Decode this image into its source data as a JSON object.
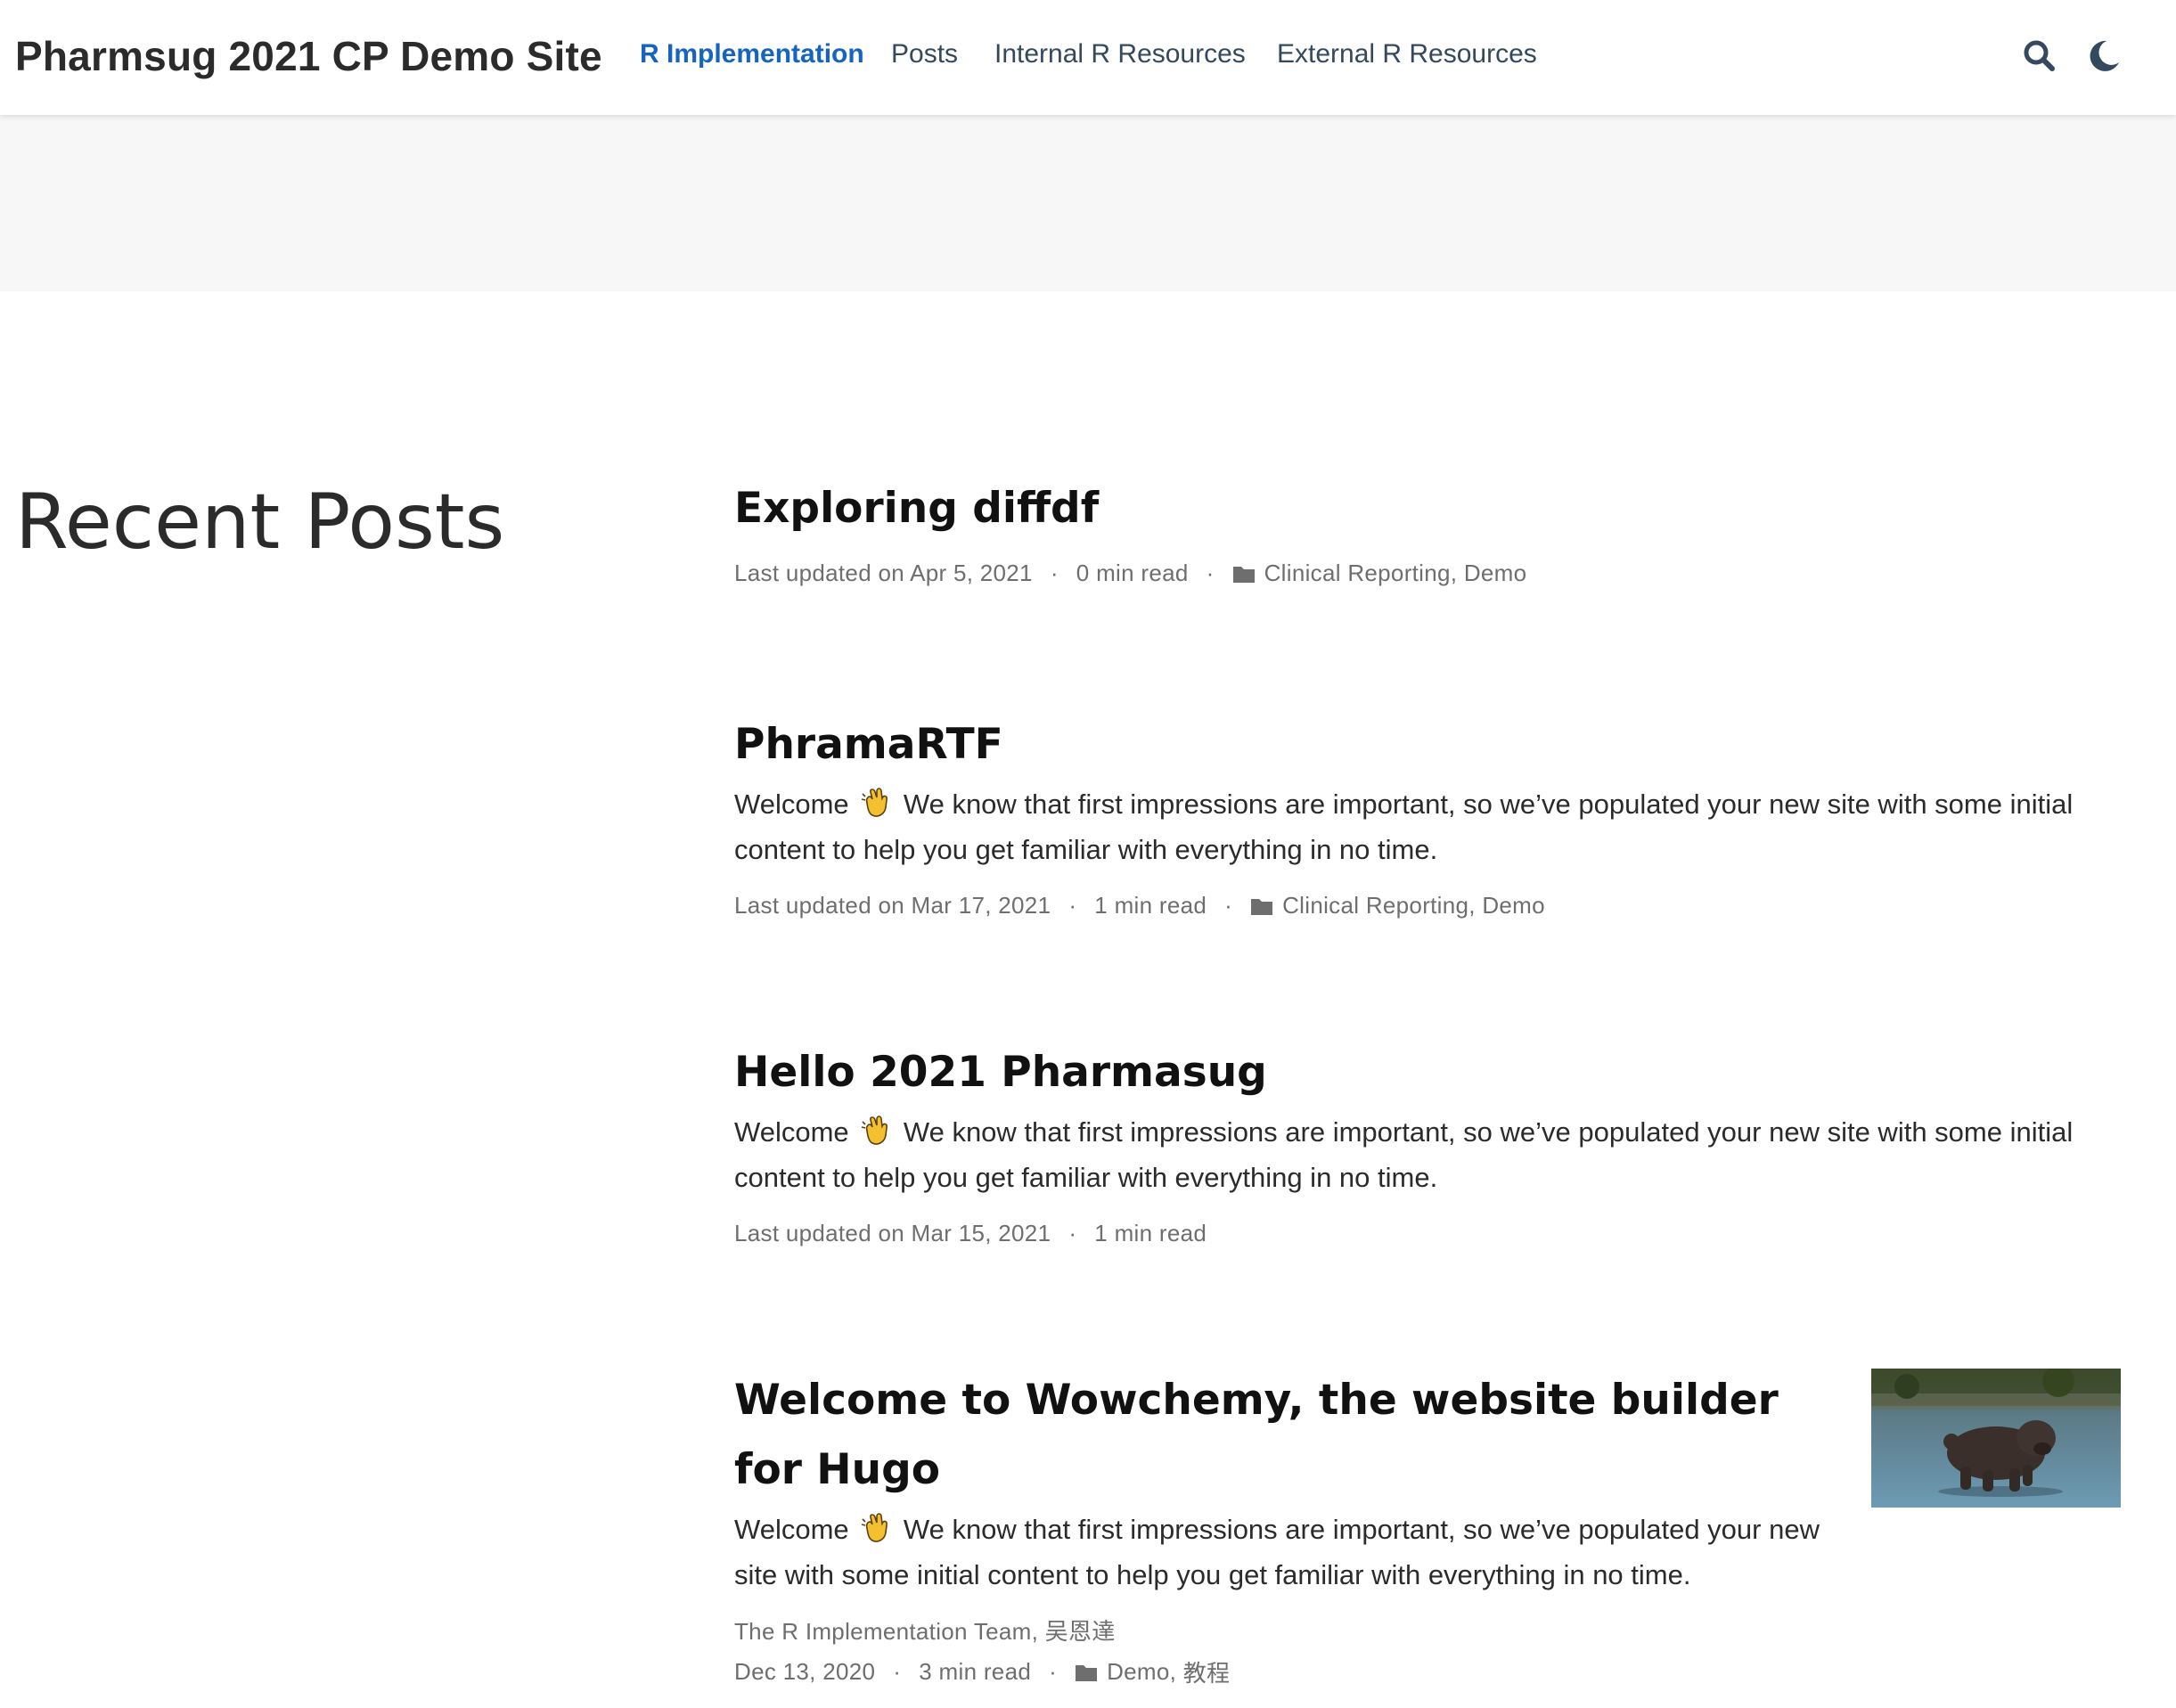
{
  "navbar": {
    "brand": "Pharmsug 2021 CP Demo Site",
    "links": [
      {
        "label": "R Implementation",
        "active": true
      },
      {
        "label": "Posts",
        "active": false
      },
      {
        "label": "Internal R Resources",
        "active": false
      },
      {
        "label": "External R Resources",
        "active": false
      }
    ],
    "icons": [
      "search-icon",
      "moon-icon"
    ]
  },
  "section": {
    "title": "Recent Posts"
  },
  "posts": [
    {
      "title": "Exploring diffdf",
      "meta": {
        "updated": "Last updated on Apr 5, 2021",
        "read": "0 min read",
        "categories": [
          "Clinical Reporting",
          "Demo"
        ]
      }
    },
    {
      "title": "PhramaRTF",
      "summary_before": "Welcome",
      "summary_after": "We know that first impressions are important, so we’ve populated your new site with some initial content to help you get familiar with everything in no time.",
      "meta": {
        "updated": "Last updated on Mar 17, 2021",
        "read": "1 min read",
        "categories": [
          "Clinical Reporting",
          "Demo"
        ]
      }
    },
    {
      "title": "Hello 2021 Pharmasug",
      "summary_before": "Welcome",
      "summary_after": "We know that first impressions are important, so we’ve populated your new site with some initial content to help you get familiar with everything in no time.",
      "meta": {
        "updated": "Last updated on Mar 15, 2021",
        "read": "1 min read"
      }
    },
    {
      "title": "Welcome to Wowchemy, the website builder for Hugo",
      "summary_before": "Welcome",
      "summary_after": "We know that first impressions are important, so we’ve populated your new site with some initial content to help you get familiar with everything in no time.",
      "authors": "The R Implementation Team, 吴恩達",
      "meta": {
        "date": "Dec 13, 2020",
        "read": "3 min read",
        "categories": [
          "Demo",
          "教程"
        ]
      }
    }
  ],
  "separator": "·",
  "comma": ",",
  "colors": {
    "accent": "#1565c0",
    "hero_bg": "#f7f7f7",
    "meta": "#6e6e6e"
  }
}
